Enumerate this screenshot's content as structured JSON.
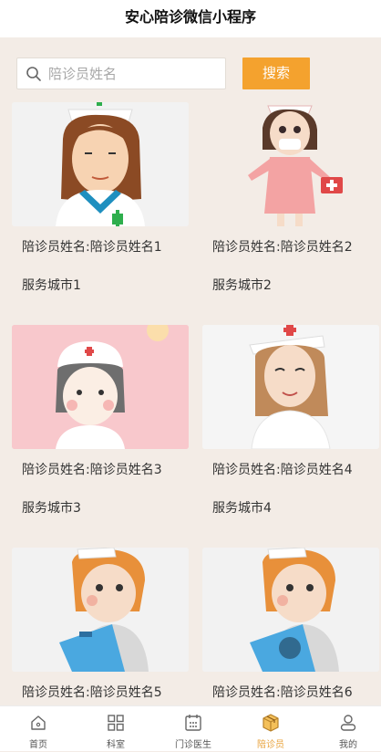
{
  "header": {
    "title": "安心陪诊微信小程序"
  },
  "search": {
    "placeholder": "陪诊员姓名",
    "value": "",
    "button_label": "搜索"
  },
  "escorts": [
    {
      "name": "陪诊员姓名:陪诊员姓名1",
      "city": "服务城市1"
    },
    {
      "name": "陪诊员姓名:陪诊员姓名2",
      "city": "服务城市2"
    },
    {
      "name": "陪诊员姓名:陪诊员姓名3",
      "city": "服务城市3"
    },
    {
      "name": "陪诊员姓名:陪诊员姓名4",
      "city": "服务城市4"
    },
    {
      "name": "陪诊员姓名:陪诊员姓名5",
      "city": ""
    },
    {
      "name": "陪诊员姓名:陪诊员姓名6",
      "city": ""
    }
  ],
  "tabbar": {
    "items": [
      {
        "label": "首页",
        "icon": "home-icon"
      },
      {
        "label": "科室",
        "icon": "grid-icon"
      },
      {
        "label": "门诊医生",
        "icon": "calendar-icon"
      },
      {
        "label": "陪诊员",
        "icon": "box-icon",
        "active": true
      },
      {
        "label": "我的",
        "icon": "user-icon"
      }
    ]
  },
  "colors": {
    "accent": "#f4a22e",
    "active_tab": "#e8a23a",
    "background": "#f3ece6"
  }
}
